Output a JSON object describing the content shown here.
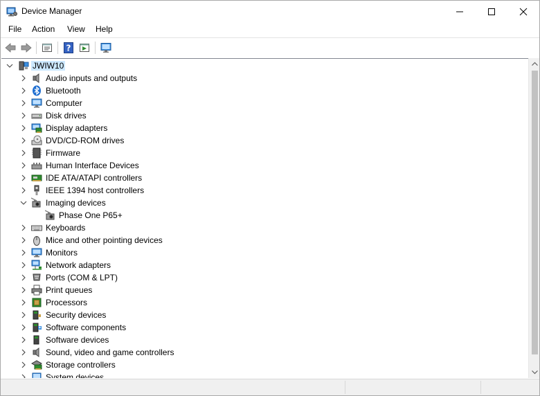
{
  "window": {
    "title": "Device Manager"
  },
  "menu": [
    "File",
    "Action",
    "View",
    "Help"
  ],
  "toolbar": {
    "buttons": [
      "back-icon",
      "forward-icon",
      "properties-icon",
      "help-icon",
      "run-icon",
      "monitor-icon"
    ]
  },
  "tree": {
    "root": "JWIW10",
    "items": [
      {
        "label": "Audio inputs and outputs",
        "icon": "speaker-icon",
        "expanded": false
      },
      {
        "label": "Bluetooth",
        "icon": "bluetooth-icon",
        "expanded": false
      },
      {
        "label": "Computer",
        "icon": "computer-icon",
        "expanded": false
      },
      {
        "label": "Disk drives",
        "icon": "disk-icon",
        "expanded": false
      },
      {
        "label": "Display adapters",
        "icon": "display-adapter-icon",
        "expanded": false
      },
      {
        "label": "DVD/CD-ROM drives",
        "icon": "dvd-icon",
        "expanded": false
      },
      {
        "label": "Firmware",
        "icon": "firmware-icon",
        "expanded": false
      },
      {
        "label": "Human Interface Devices",
        "icon": "hid-icon",
        "expanded": false
      },
      {
        "label": "IDE ATA/ATAPI controllers",
        "icon": "ide-icon",
        "expanded": false
      },
      {
        "label": "IEEE 1394 host controllers",
        "icon": "ieee1394-icon",
        "expanded": false
      },
      {
        "label": "Imaging devices",
        "icon": "camera-icon",
        "expanded": true
      },
      {
        "label": "Phase One P65+",
        "icon": "camera-icon",
        "child": true
      },
      {
        "label": "Keyboards",
        "icon": "keyboard-icon",
        "expanded": false
      },
      {
        "label": "Mice and other pointing devices",
        "icon": "mouse-icon",
        "expanded": false
      },
      {
        "label": "Monitors",
        "icon": "monitor-icon",
        "expanded": false
      },
      {
        "label": "Network adapters",
        "icon": "network-icon",
        "expanded": false
      },
      {
        "label": "Ports (COM & LPT)",
        "icon": "port-icon",
        "expanded": false
      },
      {
        "label": "Print queues",
        "icon": "printer-icon",
        "expanded": false
      },
      {
        "label": "Processors",
        "icon": "processor-icon",
        "expanded": false
      },
      {
        "label": "Security devices",
        "icon": "security-icon",
        "expanded": false
      },
      {
        "label": "Software components",
        "icon": "software-component-icon",
        "expanded": false
      },
      {
        "label": "Software devices",
        "icon": "software-device-icon",
        "expanded": false
      },
      {
        "label": "Sound, video and game controllers",
        "icon": "sound-icon",
        "expanded": false
      },
      {
        "label": "Storage controllers",
        "icon": "storage-icon",
        "expanded": false
      },
      {
        "label": "System devices",
        "icon": "system-icon",
        "expanded": false
      }
    ]
  },
  "colors": {
    "selection": "#cce8ff",
    "accent": "#0078d7"
  }
}
